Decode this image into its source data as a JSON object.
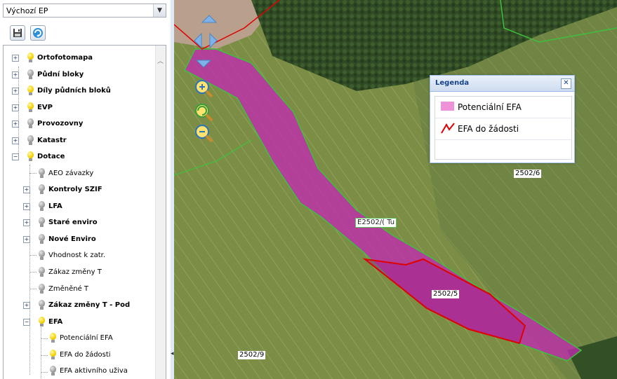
{
  "preset_select": {
    "value": "Výchozí EP"
  },
  "toolbar": {
    "save_icon": "floppy-disk-icon",
    "refresh_icon": "refresh-icon"
  },
  "tree": {
    "items": [
      {
        "label": "Ortofotomapa",
        "bold": true,
        "bulb": "on"
      },
      {
        "label": "Půdní bloky",
        "bold": true,
        "bulb": "off"
      },
      {
        "label": "Díly půdních bloků",
        "bold": true,
        "bulb": "on"
      },
      {
        "label": "EVP",
        "bold": true,
        "bulb": "on"
      },
      {
        "label": "Provozovny",
        "bold": true,
        "bulb": "off"
      },
      {
        "label": "Katastr",
        "bold": true,
        "bulb": "off"
      },
      {
        "label": "Dotace",
        "bold": true,
        "bulb": "on"
      },
      {
        "label": "AEO závazky",
        "bold": false,
        "bulb": "off"
      },
      {
        "label": "Kontroly SZIF",
        "bold": true,
        "bulb": "off"
      },
      {
        "label": "LFA",
        "bold": true,
        "bulb": "off"
      },
      {
        "label": "Staré enviro",
        "bold": true,
        "bulb": "off"
      },
      {
        "label": "Nové Enviro",
        "bold": true,
        "bulb": "off"
      },
      {
        "label": "Vhodnost k zatr.",
        "bold": false,
        "bulb": "off"
      },
      {
        "label": "Zákaz změny T",
        "bold": false,
        "bulb": "off"
      },
      {
        "label": "Změněné T",
        "bold": false,
        "bulb": "off"
      },
      {
        "label": "Zákaz změny T - Pod",
        "bold": true,
        "bulb": "off"
      },
      {
        "label": "EFA",
        "bold": true,
        "bulb": "on"
      },
      {
        "label": "Potenciální EFA",
        "bold": false,
        "bulb": "on"
      },
      {
        "label": "EFA do žádosti",
        "bold": false,
        "bulb": "on"
      },
      {
        "label": "EFA aktivního uživa",
        "bold": false,
        "bulb": "off"
      }
    ]
  },
  "legend": {
    "title": "Legenda",
    "items": [
      {
        "label": "Potenciální EFA",
        "color": "#ef93d9"
      },
      {
        "label": "EFA do žádosti",
        "color": "#e00000"
      }
    ]
  },
  "map": {
    "parcels": [
      {
        "label": "2502/6"
      },
      {
        "label": "2502/5"
      },
      {
        "label": "2502/9"
      },
      {
        "label": "E2502/( Tu"
      }
    ],
    "colors": {
      "efa_fill": "#c22ab0",
      "efa_border": "#e00000",
      "block_border": "#3fc03f"
    }
  }
}
